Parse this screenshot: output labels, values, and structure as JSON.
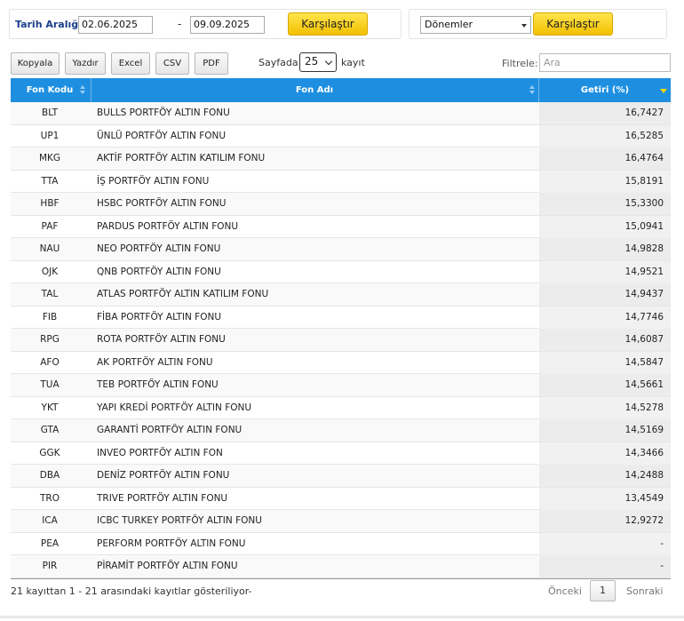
{
  "date_range": {
    "label": "Tarih Aralığı",
    "from": "02.06.2025",
    "separator": "-",
    "to": "09.09.2025",
    "compare_label": "Karşılaştır"
  },
  "periods": {
    "selected": "Dönemler",
    "compare_label": "Karşılaştır"
  },
  "toolbar": {
    "copy": "Kopyala",
    "print": "Yazdır",
    "excel": "Excel",
    "csv": "CSV",
    "pdf": "PDF",
    "page_size_label": "Sayfada",
    "page_size": "25",
    "records_label": "kayıt",
    "filter_label": "Filtrele:",
    "filter_placeholder": "Ara"
  },
  "table": {
    "headers": {
      "code": "Fon Kodu",
      "name": "Fon Adı",
      "return": "Getiri (%)"
    },
    "rows": [
      {
        "code": "BLT",
        "name": "BULLS PORTFÖY ALTIN FONU",
        "return": "16,7427"
      },
      {
        "code": "UP1",
        "name": "ÜNLÜ PORTFÖY ALTIN FONU",
        "return": "16,5285"
      },
      {
        "code": "MKG",
        "name": "AKTİF PORTFÖY ALTIN KATILIM FONU",
        "return": "16,4764"
      },
      {
        "code": "TTA",
        "name": "İŞ PORTFÖY ALTIN FONU",
        "return": "15,8191"
      },
      {
        "code": "HBF",
        "name": "HSBC PORTFÖY ALTIN FONU",
        "return": "15,3300"
      },
      {
        "code": "PAF",
        "name": "PARDUS PORTFÖY ALTIN FONU",
        "return": "15,0941"
      },
      {
        "code": "NAU",
        "name": "NEO PORTFÖY ALTIN FONU",
        "return": "14,9828"
      },
      {
        "code": "OJK",
        "name": "QNB PORTFÖY ALTIN FONU",
        "return": "14,9521"
      },
      {
        "code": "TAL",
        "name": "ATLAS PORTFÖY ALTIN KATILIM FONU",
        "return": "14,9437"
      },
      {
        "code": "FIB",
        "name": "FİBA PORTFÖY ALTIN FONU",
        "return": "14,7746"
      },
      {
        "code": "RPG",
        "name": "ROTA PORTFÖY ALTIN FONU",
        "return": "14,6087"
      },
      {
        "code": "AFO",
        "name": "AK PORTFÖY ALTIN FONU",
        "return": "14,5847"
      },
      {
        "code": "TUA",
        "name": "TEB PORTFÖY ALTIN FONU",
        "return": "14,5661"
      },
      {
        "code": "YKT",
        "name": "YAPI KREDİ PORTFÖY ALTIN FONU",
        "return": "14,5278"
      },
      {
        "code": "GTA",
        "name": "GARANTİ PORTFÖY ALTIN FONU",
        "return": "14,5169"
      },
      {
        "code": "GGK",
        "name": "INVEO PORTFÖY ALTIN FON",
        "return": "14,3466"
      },
      {
        "code": "DBA",
        "name": "DENİZ PORTFÖY ALTIN FONU",
        "return": "14,2488"
      },
      {
        "code": "TRO",
        "name": "TRIVE PORTFÖY ALTIN FONU",
        "return": "13,4549"
      },
      {
        "code": "ICA",
        "name": "ICBC TURKEY PORTFÖY ALTIN FONU",
        "return": "12,9272"
      },
      {
        "code": "PEA",
        "name": "PERFORM PORTFÖY ALTIN FONU",
        "return": "-"
      },
      {
        "code": "PIR",
        "name": "PİRAMİT PORTFÖY ALTIN FONU",
        "return": "-"
      }
    ]
  },
  "footer": {
    "info": "21 kayıttan 1 - 21 arasındaki kayıtlar gösteriliyor-",
    "prev": "Önceki",
    "current_page": "1",
    "next": "Sonraki"
  }
}
